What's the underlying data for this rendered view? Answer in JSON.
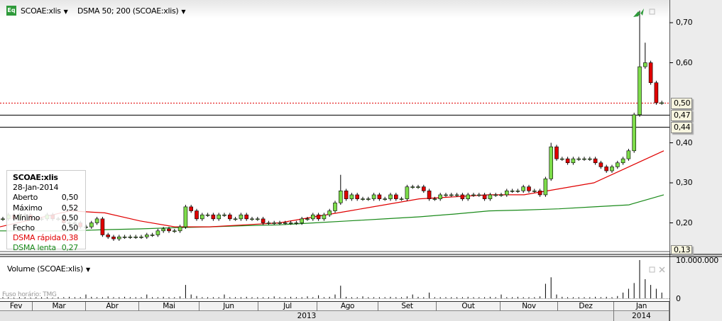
{
  "header": {
    "symbol": "SCOAE:xlis",
    "indicator": "DSMA 50; 200 (SCOAE:xlis)",
    "eq_badge": "Eq"
  },
  "legend": {
    "title": "SCOAE:xlis",
    "date": "28-Jan-2014",
    "rows": [
      {
        "label": "Aberto",
        "value": "0,50",
        "color": "#000000"
      },
      {
        "label": "Máximo",
        "value": "0,52",
        "color": "#000000"
      },
      {
        "label": "Mínimo",
        "value": "0,50",
        "color": "#000000"
      },
      {
        "label": "Fecho",
        "value": "0,50",
        "color": "#000000"
      },
      {
        "label": "DSMA rápida",
        "value": "0,38",
        "color": "#e00000"
      },
      {
        "label": "DSMA lenta",
        "value": "0,27",
        "color": "#1a8a1a"
      }
    ]
  },
  "price_axis": {
    "ticks": [
      "0,70",
      "0,60",
      "0,40",
      "0,30",
      "0,20"
    ],
    "tick_values": [
      0.7,
      0.6,
      0.4,
      0.3,
      0.2
    ],
    "low_label": "0,13",
    "markers": [
      {
        "label": "0,50",
        "value": 0.5,
        "style": "red-dotted"
      },
      {
        "label": "0,47",
        "value": 0.47,
        "style": "black"
      },
      {
        "label": "0,44",
        "value": 0.44,
        "style": "black"
      }
    ]
  },
  "volume": {
    "title": "Volume (SCOAE:xlis)",
    "axis_top": "10.000.000",
    "axis_zero": "0",
    "timezone": "Fuso horário: TMG"
  },
  "time_axis": {
    "months": [
      "Fev",
      "Mar",
      "Abr",
      "Mai",
      "Jun",
      "Jul",
      "Ago",
      "Set",
      "Out",
      "Nov",
      "Dez",
      "Jan"
    ],
    "years": [
      "2013",
      "2014"
    ]
  },
  "colors": {
    "up": "#7ddc4a",
    "down": "#e00000",
    "fast": "#e00000",
    "slow": "#1a8a1a"
  },
  "chart_data": {
    "type": "candlestick",
    "closes": [
      0.21,
      0.22,
      0.21,
      0.22,
      0.22,
      0.21,
      0.21,
      0.21,
      0.22,
      0.21,
      0.21,
      0.2,
      0.2,
      0.2,
      0.19,
      0.19,
      0.2,
      0.21,
      0.17,
      0.165,
      0.16,
      0.165,
      0.165,
      0.165,
      0.165,
      0.165,
      0.17,
      0.17,
      0.18,
      0.185,
      0.18,
      0.18,
      0.19,
      0.24,
      0.23,
      0.21,
      0.22,
      0.22,
      0.21,
      0.22,
      0.22,
      0.21,
      0.21,
      0.22,
      0.21,
      0.21,
      0.21,
      0.2,
      0.2,
      0.2,
      0.2,
      0.2,
      0.2,
      0.2,
      0.21,
      0.21,
      0.22,
      0.21,
      0.22,
      0.23,
      0.25,
      0.28,
      0.26,
      0.27,
      0.26,
      0.26,
      0.26,
      0.27,
      0.26,
      0.26,
      0.27,
      0.26,
      0.26,
      0.29,
      0.29,
      0.29,
      0.28,
      0.26,
      0.26,
      0.27,
      0.27,
      0.27,
      0.27,
      0.26,
      0.27,
      0.27,
      0.27,
      0.26,
      0.27,
      0.27,
      0.27,
      0.28,
      0.28,
      0.28,
      0.29,
      0.28,
      0.28,
      0.27,
      0.31,
      0.39,
      0.36,
      0.36,
      0.35,
      0.36,
      0.36,
      0.36,
      0.36,
      0.35,
      0.34,
      0.33,
      0.34,
      0.35,
      0.36,
      0.38,
      0.47,
      0.59,
      0.6,
      0.55,
      0.5,
      0.5
    ],
    "high_spikes": {
      "61": 0.32,
      "115": 0.73,
      "116": 0.65,
      "99": 0.4
    },
    "dsma_fast": [
      0.19,
      0.21,
      0.23,
      0.225,
      0.205,
      0.19,
      0.19,
      0.195,
      0.2,
      0.215,
      0.23,
      0.245,
      0.26,
      0.265,
      0.27,
      0.27,
      0.285,
      0.3,
      0.34,
      0.38
    ],
    "dsma_slow": [
      0.18,
      0.18,
      0.18,
      0.183,
      0.185,
      0.188,
      0.19,
      0.193,
      0.195,
      0.2,
      0.205,
      0.21,
      0.215,
      0.222,
      0.23,
      0.232,
      0.235,
      0.24,
      0.245,
      0.27
    ],
    "volume_millions": [
      0.3,
      0.3,
      0.2,
      0.3,
      0.3,
      0.2,
      0.3,
      0.3,
      0.3,
      0.2,
      0.3,
      0.3,
      0.4,
      0.3,
      0.3,
      1.0,
      0.4,
      0.3,
      0.3,
      0.5,
      0.3,
      0.3,
      0.4,
      0.3,
      0.3,
      0.3,
      1.0,
      0.3,
      0.3,
      0.4,
      0.3,
      0.3,
      0.5,
      3.5,
      1.0,
      0.6,
      0.3,
      0.3,
      0.3,
      0.3,
      1.0,
      0.3,
      0.3,
      0.3,
      0.4,
      0.3,
      0.3,
      0.3,
      0.3,
      0.5,
      0.3,
      0.3,
      0.4,
      0.3,
      0.3,
      0.5,
      0.3,
      0.8,
      0.3,
      0.4,
      1.0,
      3.3,
      0.4,
      0.3,
      0.3,
      0.5,
      0.3,
      0.3,
      0.3,
      0.3,
      0.4,
      0.3,
      0.3,
      0.5,
      1.0,
      0.4,
      0.3,
      1.5,
      0.3,
      0.3,
      0.3,
      0.3,
      0.3,
      0.3,
      0.4,
      0.3,
      0.3,
      0.3,
      0.4,
      0.3,
      1.0,
      0.3,
      0.3,
      0.4,
      0.3,
      0.3,
      0.3,
      0.5,
      3.8,
      5.5,
      1.0,
      0.4,
      0.3,
      0.3,
      0.3,
      0.3,
      0.3,
      0.4,
      0.3,
      0.4,
      0.3,
      0.6,
      1.5,
      2.5,
      4.0,
      10.0,
      5.0,
      3.5,
      2.5,
      1.5
    ],
    "ylim": [
      0.13,
      0.74
    ]
  }
}
